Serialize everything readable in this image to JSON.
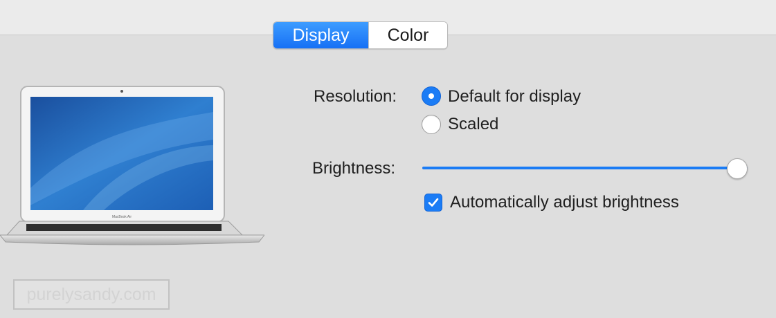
{
  "tabs": [
    {
      "label": "Display",
      "active": true
    },
    {
      "label": "Color",
      "active": false
    }
  ],
  "device": {
    "name": "laptop-illustration",
    "screen_label": "MacBook Air"
  },
  "resolution": {
    "label": "Resolution:",
    "options": [
      {
        "label": "Default for display",
        "selected": true
      },
      {
        "label": "Scaled",
        "selected": false
      }
    ]
  },
  "brightness": {
    "label": "Brightness:",
    "value_percent": 100
  },
  "auto_brightness": {
    "label": "Automatically adjust brightness",
    "checked": true
  },
  "watermark": {
    "text": "purelysandy.com"
  },
  "colors": {
    "accent": "#1b7cf5",
    "background": "#dedede",
    "watermark": "#d3d3d3"
  }
}
